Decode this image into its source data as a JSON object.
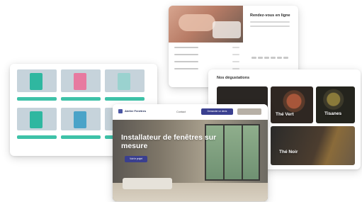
{
  "booking_card": {
    "panel_title": "Rendez-vous en ligne"
  },
  "products_card": {
    "items": [
      {
        "name": "",
        "price": "",
        "button": "",
        "box_color": "#2fb7a0"
      },
      {
        "name": "",
        "price": "",
        "button": "",
        "box_color": "#e77aa0"
      },
      {
        "name": "",
        "price": "",
        "button": "",
        "box_color": "#9ad2cf"
      },
      {
        "name": "",
        "price": "",
        "button": "",
        "box_color": "#2fb7a0"
      },
      {
        "name": "",
        "price": "",
        "button": "",
        "box_color": "#4aa3c8"
      },
      {
        "name": "",
        "price": "",
        "button": "",
        "box_color": "#e39a7a"
      }
    ],
    "accent_color": "#3ec2a8"
  },
  "teas_card": {
    "title": "Nos dégustations",
    "tiles": [
      {
        "label": "Thé Vert"
      },
      {
        "label": "Tisanes"
      },
      {
        "label": "Thé Noir"
      }
    ]
  },
  "windows_card": {
    "logo_text": "Atelier Fenêtres",
    "nav_link": "Contact",
    "nav_button": "Demander un devis",
    "nav_button2": "",
    "headline": "Installateur de fenêtres sur mesure",
    "cta": "Voir le projet",
    "brand_color": "#3a3f8f"
  }
}
